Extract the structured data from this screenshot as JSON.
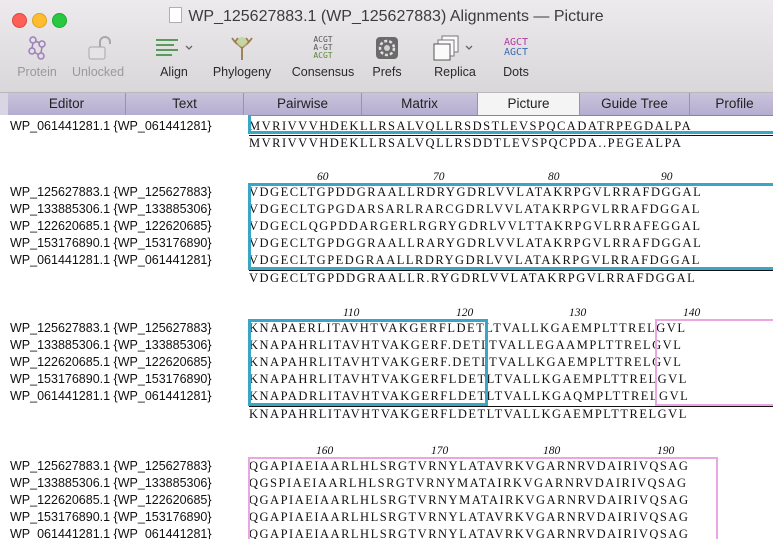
{
  "window": {
    "title": "WP_125627883.1 (WP_125627883) Alignments — Picture",
    "traffic_lights": [
      "close",
      "minimize",
      "zoom"
    ]
  },
  "toolbar": [
    {
      "name": "protein",
      "label": "Protein",
      "icon": "molecule-icon",
      "enabled": false
    },
    {
      "name": "unlocked",
      "label": "Unlocked",
      "icon": "open-lock-icon",
      "enabled": false
    },
    {
      "name": "align",
      "label": "Align",
      "icon": "align-lines-icon",
      "enabled": true,
      "dropdown": true
    },
    {
      "name": "phylogeny",
      "label": "Phylogeny",
      "icon": "tree-icon",
      "enabled": true
    },
    {
      "name": "consensus",
      "label": "Consensus",
      "icon": "acgt-stack-icon",
      "enabled": true,
      "icon_text": [
        "ACGT",
        "A-GT",
        "ACGT"
      ]
    },
    {
      "name": "prefs",
      "label": "Prefs",
      "icon": "gear-icon",
      "enabled": true
    },
    {
      "name": "replica",
      "label": "Replica",
      "icon": "stacked-windows-icon",
      "enabled": true,
      "dropdown": true
    },
    {
      "name": "dots",
      "label": "Dots",
      "icon": "acgt-dots-icon",
      "enabled": true,
      "icon_text": [
        "AGCT",
        "AGCT"
      ]
    }
  ],
  "tabs": [
    {
      "label": "Editor",
      "active": false
    },
    {
      "label": "Text",
      "active": false
    },
    {
      "label": "Pairwise",
      "active": false
    },
    {
      "label": "Matrix",
      "active": false
    },
    {
      "label": "Picture",
      "active": true
    },
    {
      "label": "Guide Tree",
      "active": false
    },
    {
      "label": "Profile",
      "active": false
    }
  ],
  "partial_block": {
    "names": [
      "WP_061441281.1 {WP_061441281}"
    ],
    "sequences": [
      "MVRIVVVHDEKLLRSALVQLLRSDSTLEVSPQCADATRPEGDALPA"
    ],
    "consensus": "MVRIVVVHDEKLLRSALVQLLRSDDTLEVSPQCPDA..PEGEALPA"
  },
  "blocks": [
    {
      "ruler": [
        "60",
        "70",
        "80",
        "90"
      ],
      "names": [
        "WP_125627883.1 {WP_125627883}",
        "WP_133885306.1 {WP_133885306}",
        "WP_122620685.1 {WP_122620685}",
        "WP_153176890.1 {WP_153176890}",
        "WP_061441281.1 {WP_061441281}"
      ],
      "sequences": [
        "VDGECLTGPDDGRAALLRDRYGDRLVVLATAKRPGVLRRAFDGGAL",
        "VDGECLTGPGDARSARLRARCGDRLVVLATAKRPGVLRRAFDGGAL",
        "VDGECLQGPDDARGERLRGRYGDRLVVLTTAKRPGVLRRAFEGGAL",
        "VDGECLTGPDGGRAALLRARYGDRLVVLATAKRPGVLRRAFDGGAL",
        "VDGECLTGPEDGRAALLRDRYGDRLVVLATAKRPGVLRRAFDGGAL"
      ],
      "consensus": "VDGECLTGPDDGRAALLR.RYGDRLVVLATAKRPGVLRRAFDGGAL"
    },
    {
      "ruler": [
        "110",
        "120",
        "130",
        "140"
      ],
      "names": [
        "WP_125627883.1 {WP_125627883}",
        "WP_133885306.1 {WP_133885306}",
        "WP_122620685.1 {WP_122620685}",
        "WP_153176890.1 {WP_153176890}",
        "WP_061441281.1 {WP_061441281}"
      ],
      "sequences": [
        "KNAPAERLITAVHTVAKGERFLDETLTVALLKGAEMPLTTRELGVL",
        "KNAPAHRLITAVHTVAKGERF.DETLTVALLEGAAMPLTTRELGVL",
        "KNAPAHRLITAVHTVAKGERF.DETLTVALLKGAEMPLTTRELGVL",
        "KNAPAHRLITAVHTVAKGERFLDETLTVALLKGAEMPLTTRELGVL",
        "KNAPADRLITAVHTVAKGERFLDETLTVALLKGAQMPLTTRELGVL"
      ],
      "consensus": "KNAPAHRLITAVHTVAKGERFLDETLTVALLKGAEMPLTTRELGVL"
    },
    {
      "ruler": [
        "160",
        "170",
        "180",
        "190"
      ],
      "names": [
        "WP_125627883.1 {WP_125627883}",
        "WP_133885306.1 {WP_133885306}",
        "WP_122620685.1 {WP_122620685}",
        "WP_153176890.1 {WP_153176890}",
        "WP_061441281.1 {WP_061441281}"
      ],
      "sequences": [
        "QGAPIAEIAARLHLSRGTVRNYLATAVRKVGARNRVDAIRIVQSAG",
        "QGSPIAEIAARLHLSRGTVRNYMATAIRKVGARNRVDAIRIVQSAG",
        "QGAPIAEIAARLHLSRGTVRNYMATAIRKVGARNRVDAIRIVQSAG",
        "QGAPIAEIAARLHLSRGTVRNYLATAVRKVGARNRVDAIRIVQSAG",
        "QGAPIAEIAARLHLSRGTVRNYLATAVRKVGARNRVDAIRIVQSAG"
      ],
      "consensus": ""
    }
  ],
  "colors": {
    "highlight_box": "#3aa5c5",
    "region_box": "#e9a6e0",
    "tab_active": "#f4f4f4",
    "tab_inactive": "#b9b3d4"
  }
}
